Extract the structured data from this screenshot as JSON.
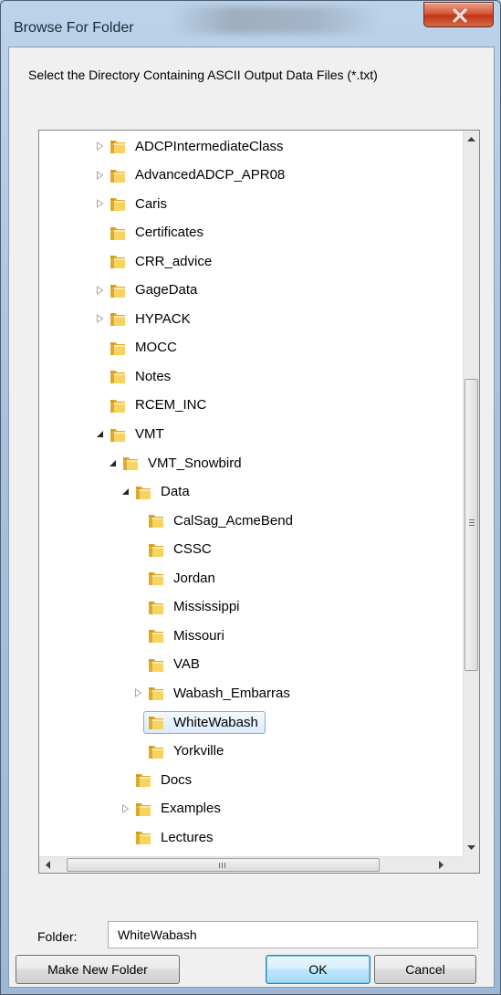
{
  "window": {
    "title": "Browse For Folder"
  },
  "description": "Select the Directory Containing ASCII Output Data Files (*.txt)",
  "tree": {
    "items": [
      {
        "label": "ADCPIntermediateClass",
        "level": 0,
        "expander": "collapsed"
      },
      {
        "label": "AdvancedADCP_APR08",
        "level": 0,
        "expander": "collapsed"
      },
      {
        "label": "Caris",
        "level": 0,
        "expander": "collapsed"
      },
      {
        "label": "Certificates",
        "level": 0,
        "expander": "none"
      },
      {
        "label": "CRR_advice",
        "level": 0,
        "expander": "none"
      },
      {
        "label": "GageData",
        "level": 0,
        "expander": "collapsed"
      },
      {
        "label": "HYPACK",
        "level": 0,
        "expander": "collapsed"
      },
      {
        "label": "MOCC",
        "level": 0,
        "expander": "none"
      },
      {
        "label": "Notes",
        "level": 0,
        "expander": "none"
      },
      {
        "label": "RCEM_INC",
        "level": 0,
        "expander": "none"
      },
      {
        "label": "VMT",
        "level": 0,
        "expander": "expanded"
      },
      {
        "label": "VMT_Snowbird",
        "level": 1,
        "expander": "expanded"
      },
      {
        "label": "Data",
        "level": 2,
        "expander": "expanded"
      },
      {
        "label": "CalSag_AcmeBend",
        "level": 3,
        "expander": "none"
      },
      {
        "label": "CSSC",
        "level": 3,
        "expander": "none"
      },
      {
        "label": "Jordan",
        "level": 3,
        "expander": "none"
      },
      {
        "label": "Mississippi",
        "level": 3,
        "expander": "none"
      },
      {
        "label": "Missouri",
        "level": 3,
        "expander": "none"
      },
      {
        "label": "VAB",
        "level": 3,
        "expander": "none"
      },
      {
        "label": "Wabash_Embarras",
        "level": 3,
        "expander": "collapsed"
      },
      {
        "label": "WhiteWabash",
        "level": 3,
        "expander": "none",
        "selected": true
      },
      {
        "label": "Yorkville",
        "level": 3,
        "expander": "none"
      },
      {
        "label": "Docs",
        "level": 2,
        "expander": "none"
      },
      {
        "label": "Examples",
        "level": 2,
        "expander": "collapsed"
      },
      {
        "label": "Lectures",
        "level": 2,
        "expander": "none"
      }
    ]
  },
  "folder_field": {
    "label": "Folder:",
    "value": "WhiteWabash"
  },
  "buttons": {
    "make_new_folder": "Make New Folder",
    "ok": "OK",
    "cancel": "Cancel"
  },
  "colors": {
    "selection_border": "#84acdd",
    "selection_fill": "#dceafc",
    "folder_yellow": "#f4c542"
  }
}
